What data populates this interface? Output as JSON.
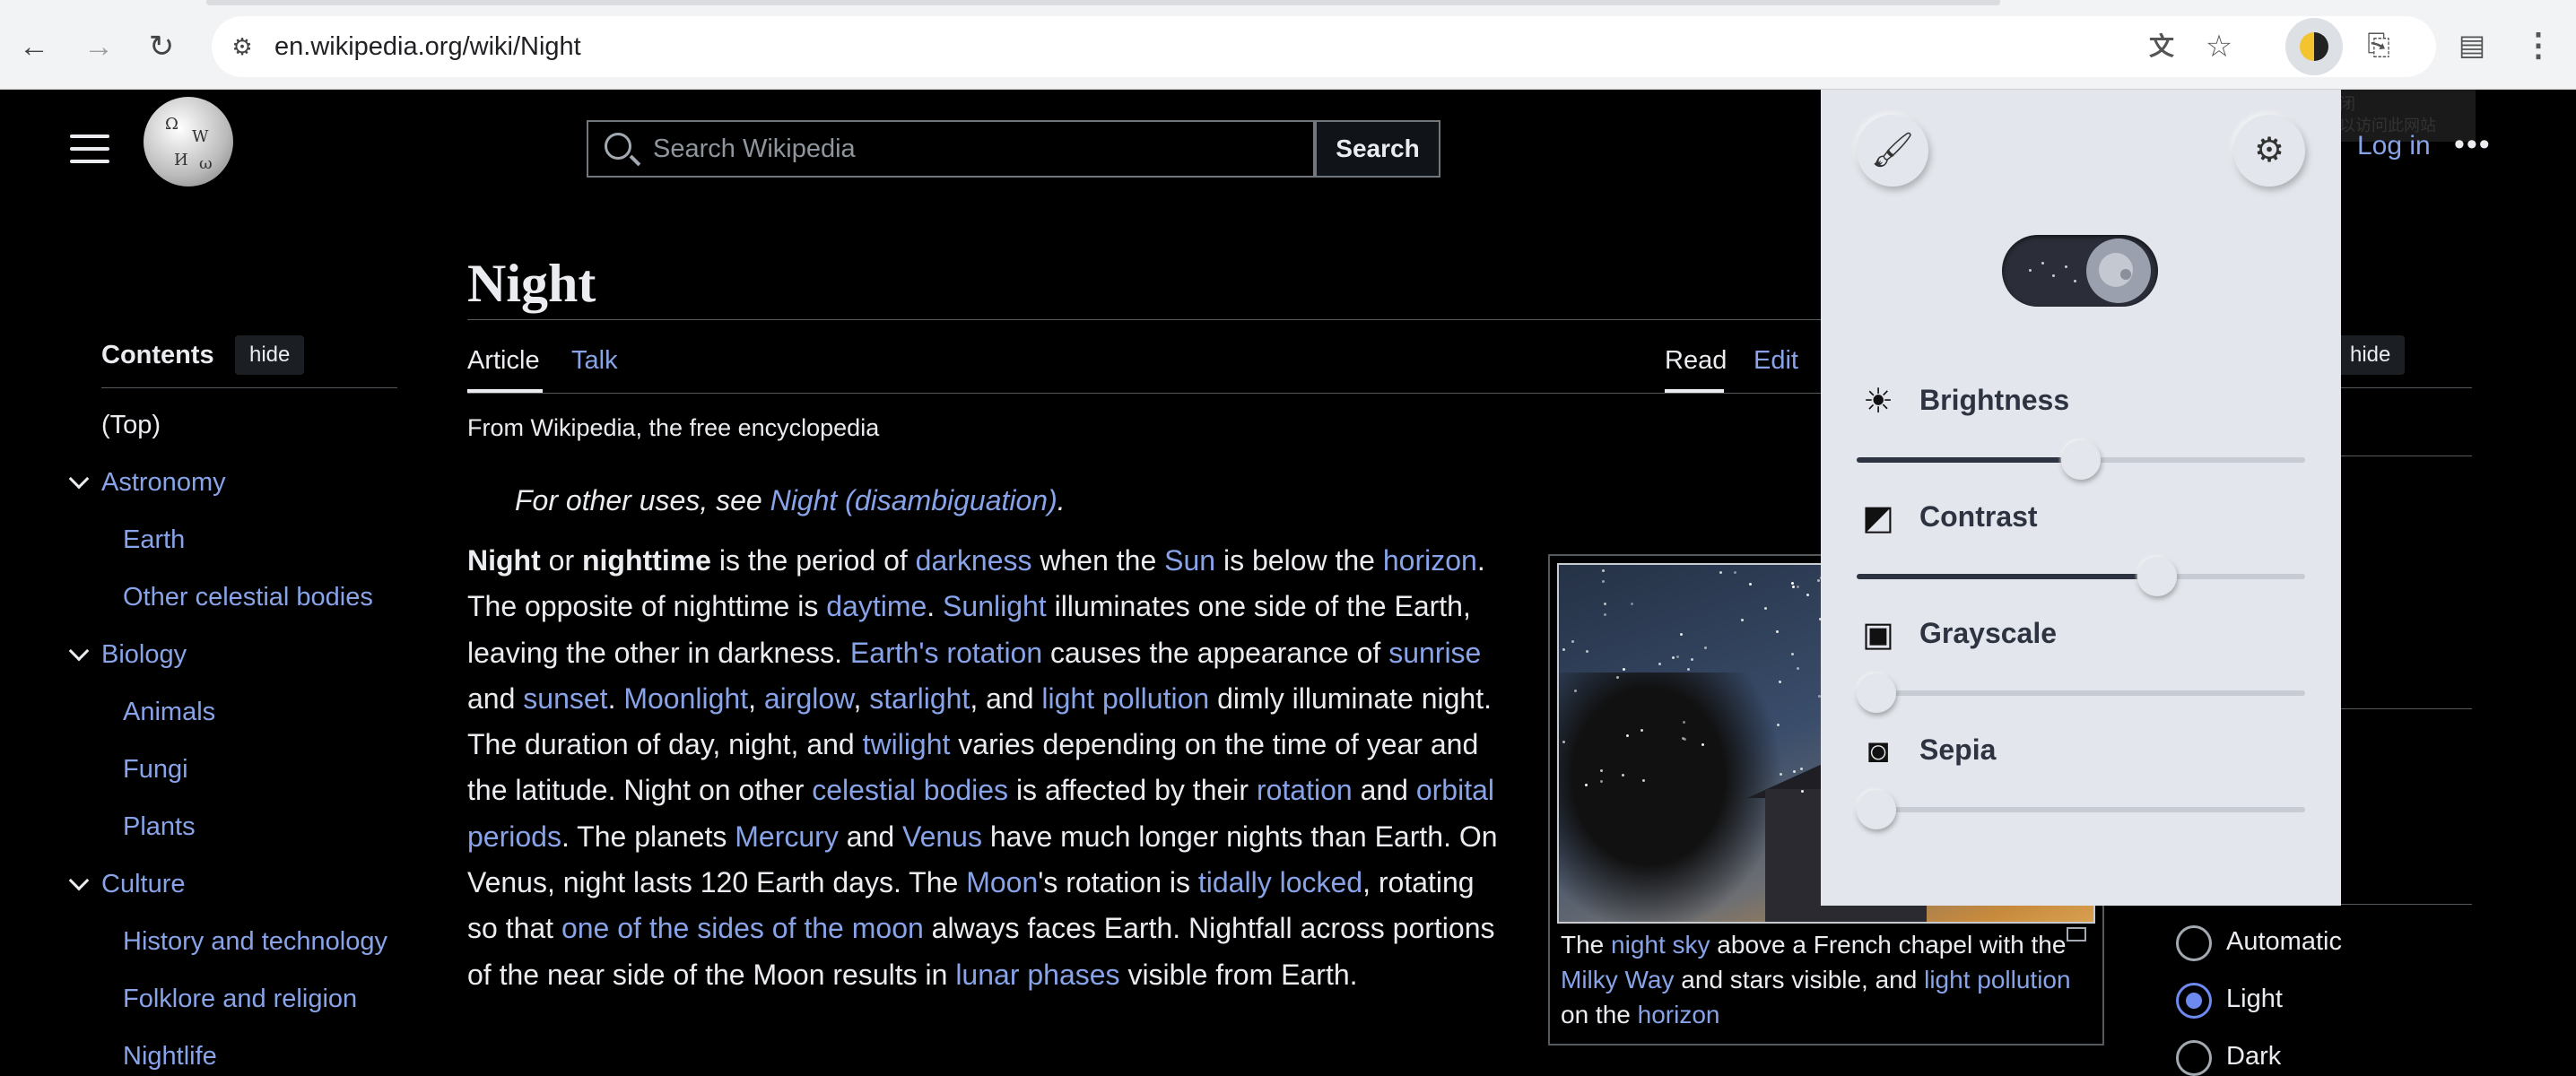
{
  "browser": {
    "url": "en.wikipedia.org/wiki/Night",
    "icons": [
      "back-icon",
      "forward-icon",
      "reload-icon",
      "site-info-icon",
      "translate-icon",
      "bookmark-star-icon",
      "dark-reader-icon",
      "extensions-icon",
      "tab-search-icon",
      "menu-icon"
    ]
  },
  "wiki_header": {
    "search_placeholder": "Search Wikipedia",
    "search_button": "Search",
    "login": "Log in",
    "more": "•••"
  },
  "tooltip": {
    "line1": "关闭",
    "line2": "可以访问此网站"
  },
  "toc": {
    "title": "Contents",
    "hide": "hide",
    "items": [
      {
        "label": "(Top)"
      },
      {
        "label": "Astronomy"
      },
      {
        "label": "Earth"
      },
      {
        "label": "Other celestial bodies"
      },
      {
        "label": "Biology"
      },
      {
        "label": "Animals"
      },
      {
        "label": "Fungi"
      },
      {
        "label": "Plants"
      },
      {
        "label": "Culture"
      },
      {
        "label": "History and technology"
      },
      {
        "label": "Folklore and religion"
      },
      {
        "label": "Nightlife"
      }
    ]
  },
  "article": {
    "title": "Night",
    "tabs": {
      "article": "Article",
      "talk": "Talk",
      "read": "Read",
      "edit": "Edit"
    },
    "from": "From Wikipedia, the free encyclopedia",
    "hatnote_prefix": "For other uses, see ",
    "hatnote_link": "Night (disambiguation)",
    "hatnote_suffix": ".",
    "body": [
      {
        "t": "Night",
        "b": true
      },
      {
        "t": " or "
      },
      {
        "t": "nighttime",
        "b": true
      },
      {
        "t": " is the period of "
      },
      {
        "t": "darkness",
        "l": true
      },
      {
        "t": " when the "
      },
      {
        "t": "Sun",
        "l": true
      },
      {
        "t": " is below the "
      },
      {
        "t": "horizon",
        "l": true
      },
      {
        "t": ". The opposite of nighttime is "
      },
      {
        "t": "daytime",
        "l": true
      },
      {
        "t": ". "
      },
      {
        "t": "Sunlight",
        "l": true
      },
      {
        "t": " illuminates one side of the Earth, leaving the other in darkness. "
      },
      {
        "t": "Earth's rotation",
        "l": true
      },
      {
        "t": " causes the appearance of "
      },
      {
        "t": "sunrise",
        "l": true
      },
      {
        "t": " and "
      },
      {
        "t": "sunset",
        "l": true
      },
      {
        "t": ". "
      },
      {
        "t": "Moonlight",
        "l": true
      },
      {
        "t": ", "
      },
      {
        "t": "airglow",
        "l": true
      },
      {
        "t": ", "
      },
      {
        "t": "starlight",
        "l": true
      },
      {
        "t": ", and "
      },
      {
        "t": "light pollution",
        "l": true
      },
      {
        "t": " dimly illuminate night. The duration of day, night, and "
      },
      {
        "t": "twilight",
        "l": true
      },
      {
        "t": " varies depending on the time of year and the latitude. Night on other "
      },
      {
        "t": "celestial bodies",
        "l": true
      },
      {
        "t": " is affected by their "
      },
      {
        "t": "rotation",
        "l": true
      },
      {
        "t": " and "
      },
      {
        "t": "orbital periods",
        "l": true
      },
      {
        "t": ". The planets "
      },
      {
        "t": "Mercury",
        "l": true
      },
      {
        "t": " and "
      },
      {
        "t": "Venus",
        "l": true
      },
      {
        "t": " have much longer nights than Earth. On Venus, night lasts 120 Earth days. The "
      },
      {
        "t": "Moon",
        "l": true
      },
      {
        "t": "'s rotation is "
      },
      {
        "t": "tidally locked",
        "l": true
      },
      {
        "t": ", rotating so that "
      },
      {
        "t": "one of the sides of the moon",
        "l": true
      },
      {
        "t": " always faces Earth. Nightfall across portions of the near side of the Moon results in "
      },
      {
        "t": "lunar phases",
        "l": true
      },
      {
        "t": " visible from Earth."
      }
    ],
    "caption": [
      {
        "t": "The "
      },
      {
        "t": "night sky",
        "l": true
      },
      {
        "t": " above a French chapel with the "
      },
      {
        "t": "Milky Way",
        "l": true
      },
      {
        "t": " and stars visible, and "
      },
      {
        "t": "light pollution",
        "l": true
      },
      {
        "t": " on the "
      },
      {
        "t": "horizon",
        "l": true
      }
    ]
  },
  "right_panel": {
    "hide": "hide",
    "options": [
      {
        "label": "Automatic",
        "selected": false
      },
      {
        "label": "Light",
        "selected": true
      },
      {
        "label": "Dark",
        "selected": false
      }
    ]
  },
  "dark_reader": {
    "mode_on": true,
    "sliders": [
      {
        "label": "Brightness",
        "icon": "sun-icon",
        "value": 0.5
      },
      {
        "label": "Contrast",
        "icon": "contrast-icon",
        "value": 0.67
      },
      {
        "label": "Grayscale",
        "icon": "grayscale-icon",
        "value": 0.0
      },
      {
        "label": "Sepia",
        "icon": "sepia-icon",
        "value": 0.0
      }
    ]
  },
  "colors": {
    "link": "#88a3e8",
    "accent": "#6d8af0",
    "popup_bg": "#e3e6ec"
  }
}
